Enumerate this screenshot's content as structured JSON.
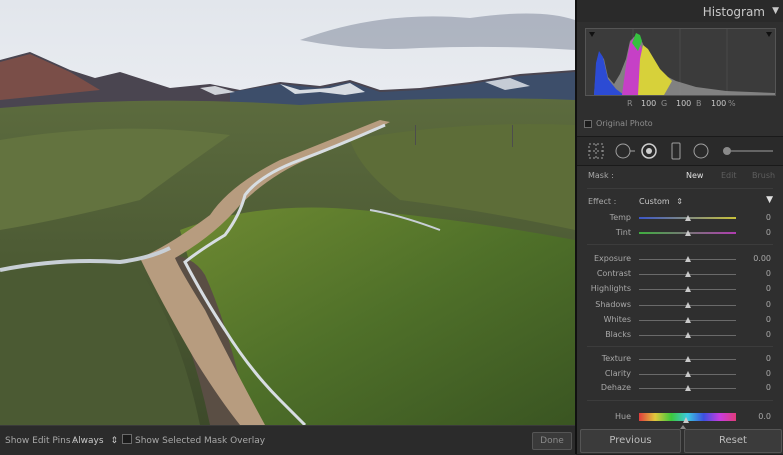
{
  "bottom_bar": {
    "edit_pins_label": "Show Edit Pins :",
    "edit_pins_value": "Always",
    "edit_pins_arrows": "⇕",
    "overlay_label": "Show Selected Mask Overlay",
    "done_label": "Done"
  },
  "histogram": {
    "title": "Histogram",
    "menu_glyph": "▼",
    "values": {
      "r_label": "R",
      "r_value": "100",
      "g_label": "G",
      "g_value": "100",
      "b_label": "B",
      "b_value": "100",
      "unit": "%"
    },
    "original_photo_label": "Original Photo"
  },
  "mask": {
    "label": "Mask :",
    "new_label": "New",
    "edit_label": "Edit",
    "brush_label": "Brush"
  },
  "effect": {
    "label": "Effect :",
    "value": "Custom",
    "arrows": "⇕",
    "collapse_glyph": "▼"
  },
  "sliders": {
    "temp": {
      "label": "Temp",
      "value": "0"
    },
    "tint": {
      "label": "Tint",
      "value": "0"
    },
    "exposure": {
      "label": "Exposure",
      "value": "0.00"
    },
    "contrast": {
      "label": "Contrast",
      "value": "0"
    },
    "highlights": {
      "label": "Highlights",
      "value": "0"
    },
    "shadows": {
      "label": "Shadows",
      "value": "0"
    },
    "whites": {
      "label": "Whites",
      "value": "0"
    },
    "blacks": {
      "label": "Blacks",
      "value": "0"
    },
    "texture": {
      "label": "Texture",
      "value": "0"
    },
    "clarity": {
      "label": "Clarity",
      "value": "0"
    },
    "dehaze": {
      "label": "Dehaze",
      "value": "0"
    },
    "hue": {
      "label": "Hue",
      "value": "0.0"
    }
  },
  "buttons": {
    "previous_label": "Previous",
    "reset_label": "Reset"
  }
}
